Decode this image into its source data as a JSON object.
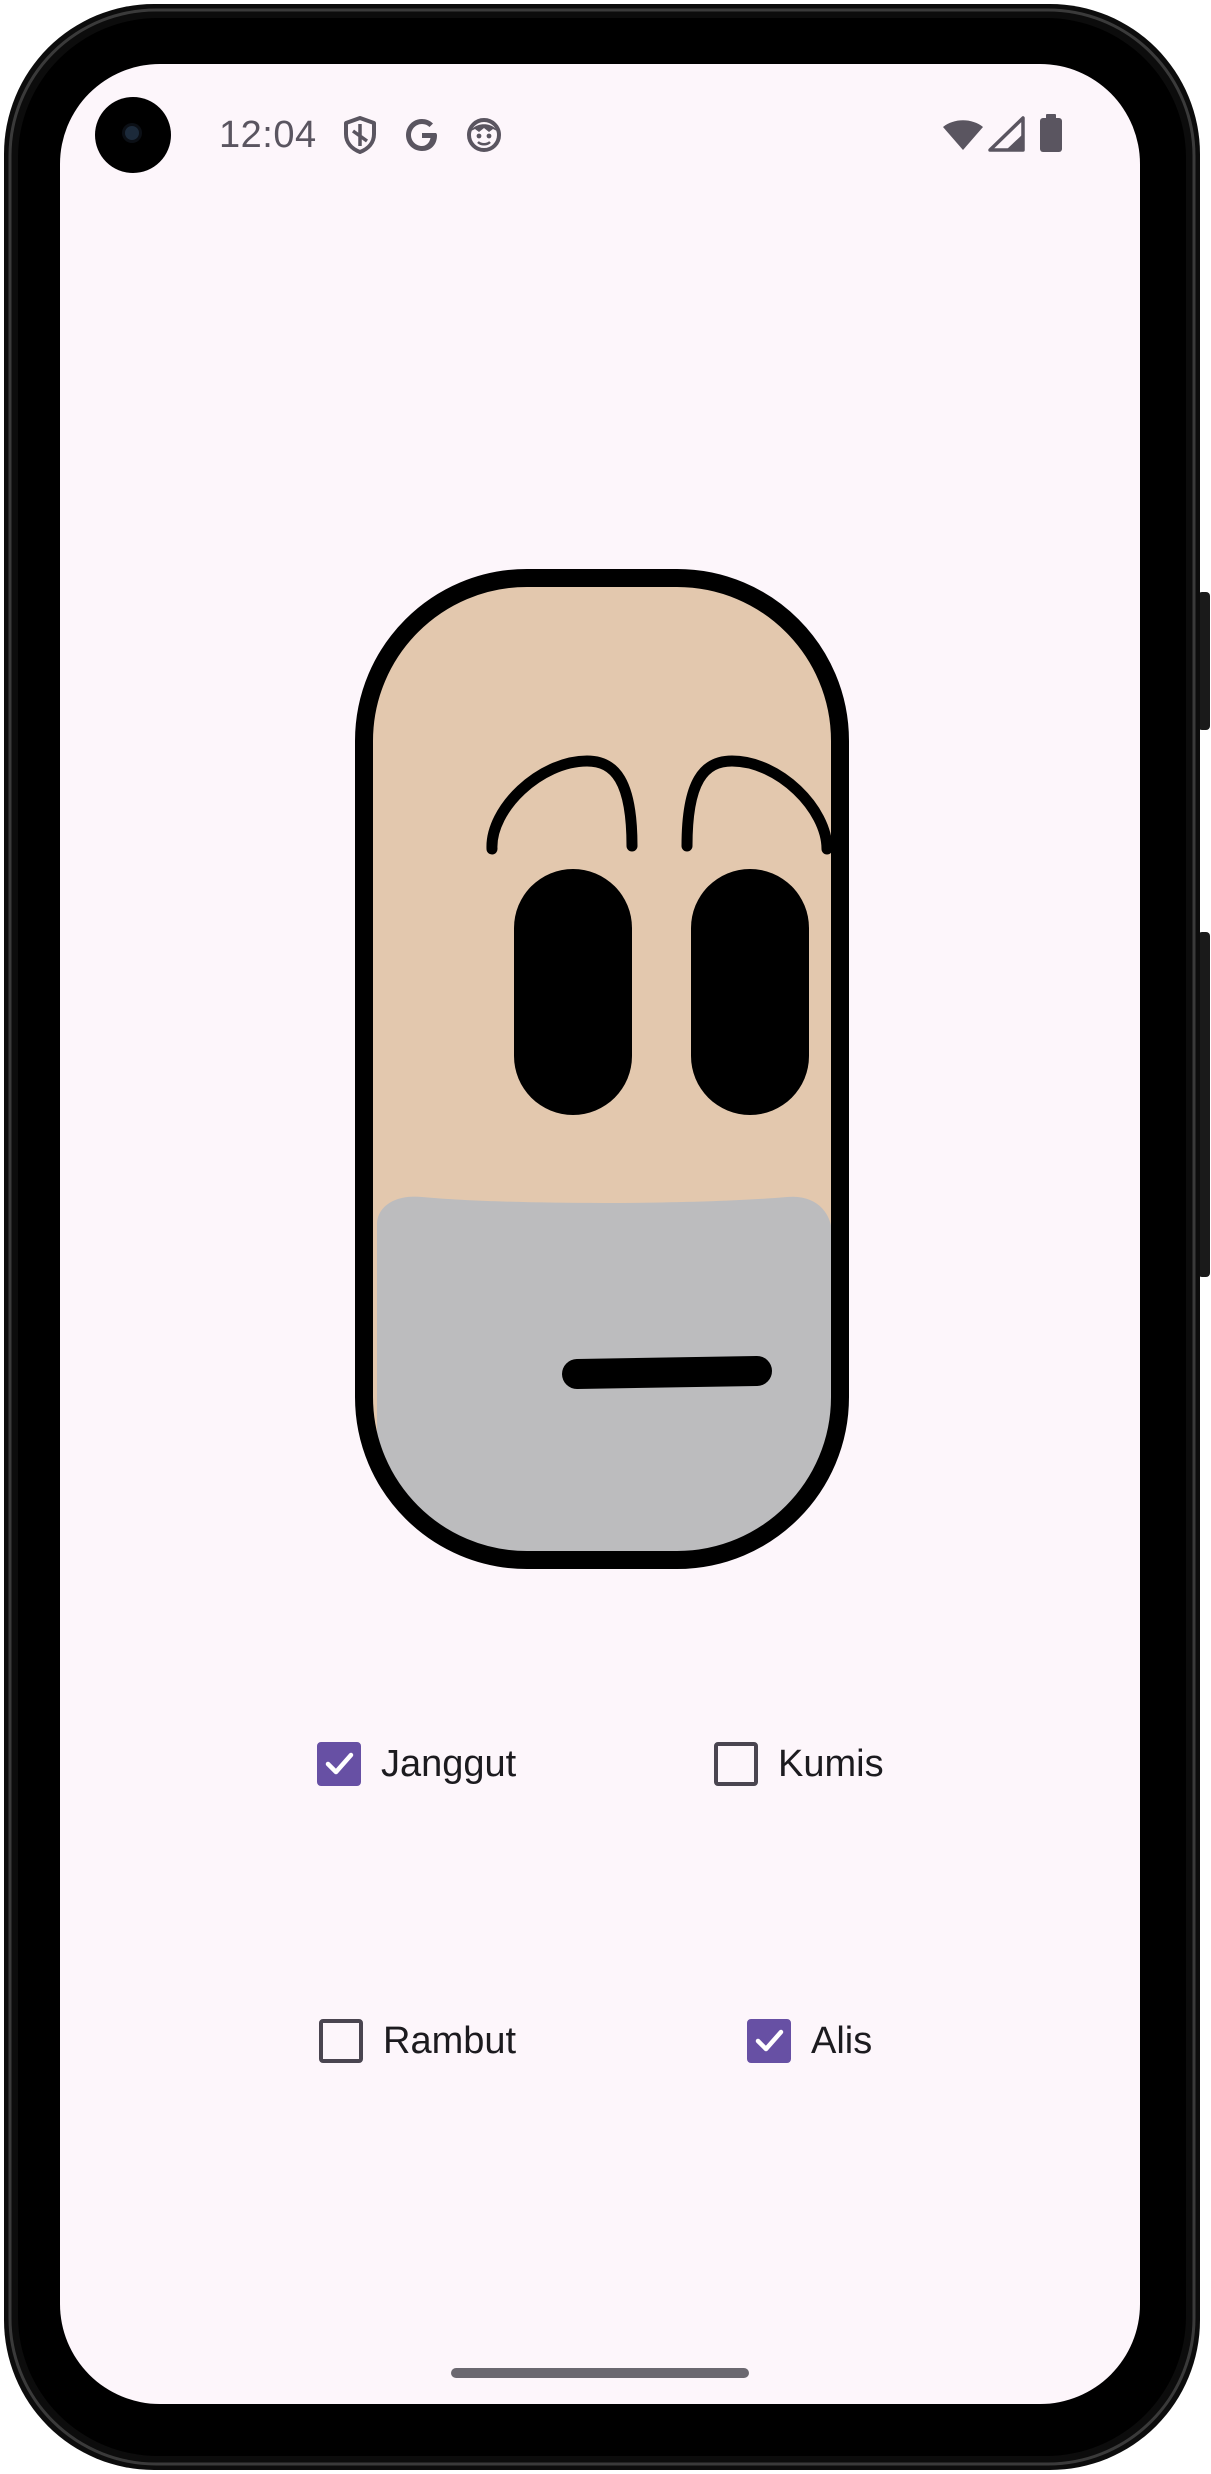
{
  "status_bar": {
    "time": "12:04",
    "icons": [
      "shield-icon",
      "google-icon",
      "face-notification-icon",
      "wifi-icon",
      "signal-icon",
      "battery-icon"
    ]
  },
  "face": {
    "skin_color": "#e3c8ae",
    "beard_color": "#bcbcbe",
    "outline_color": "#000000",
    "features_shown": [
      "eyebrows",
      "eyes",
      "beard",
      "mouth"
    ]
  },
  "options": [
    {
      "id": "janggut",
      "label": "Janggut",
      "checked": true
    },
    {
      "id": "kumis",
      "label": "Kumis",
      "checked": false
    },
    {
      "id": "rambut",
      "label": "Rambut",
      "checked": false
    },
    {
      "id": "alis",
      "label": "Alis",
      "checked": true
    }
  ],
  "colors": {
    "accent": "#6750a4",
    "background": "#fdf6fb"
  }
}
